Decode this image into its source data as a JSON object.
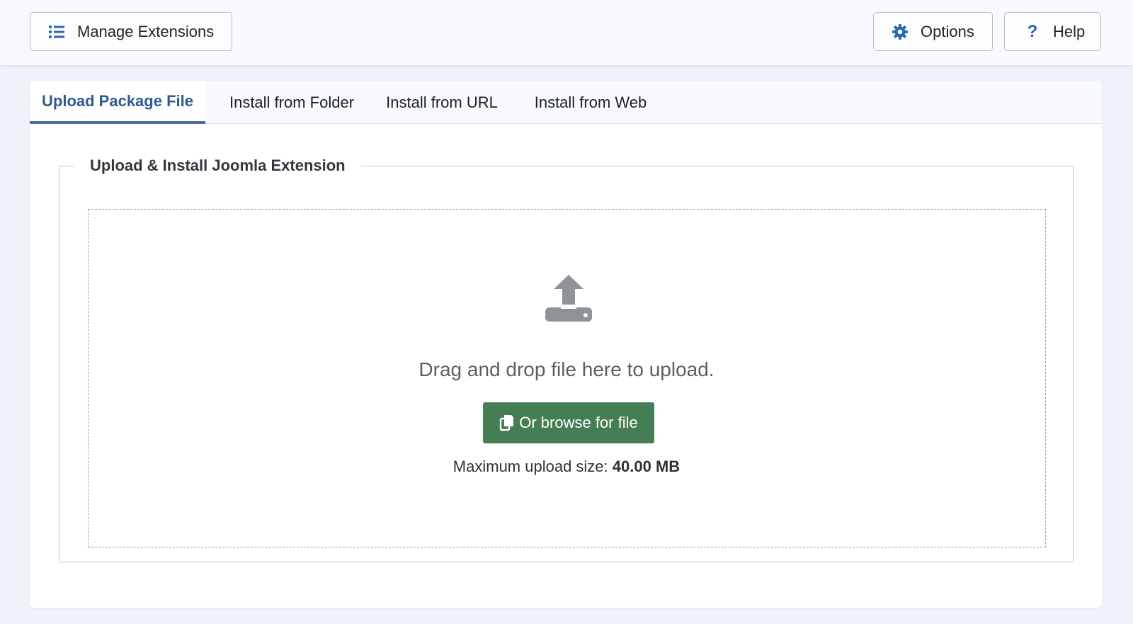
{
  "toolbar": {
    "manage_label": "Manage Extensions",
    "options_label": "Options",
    "help_label": "Help",
    "icons": {
      "manage": "list-icon",
      "options": "gear-icon",
      "help": "question-icon"
    },
    "accent_color": "#2a67b0"
  },
  "tabs": [
    {
      "label": "Upload Package File",
      "active": true
    },
    {
      "label": "Install from Folder",
      "active": false
    },
    {
      "label": "Install from URL",
      "active": false
    },
    {
      "label": "Install from Web",
      "active": false
    }
  ],
  "upload": {
    "legend": "Upload & Install Joomla Extension",
    "drag_text": "Drag and drop file here to upload.",
    "browse_label": "Or browse for file",
    "max_size_label": "Maximum upload size:",
    "max_size_value": "40.00 MB",
    "icon": "upload-icon",
    "button_color": "#457d54"
  }
}
